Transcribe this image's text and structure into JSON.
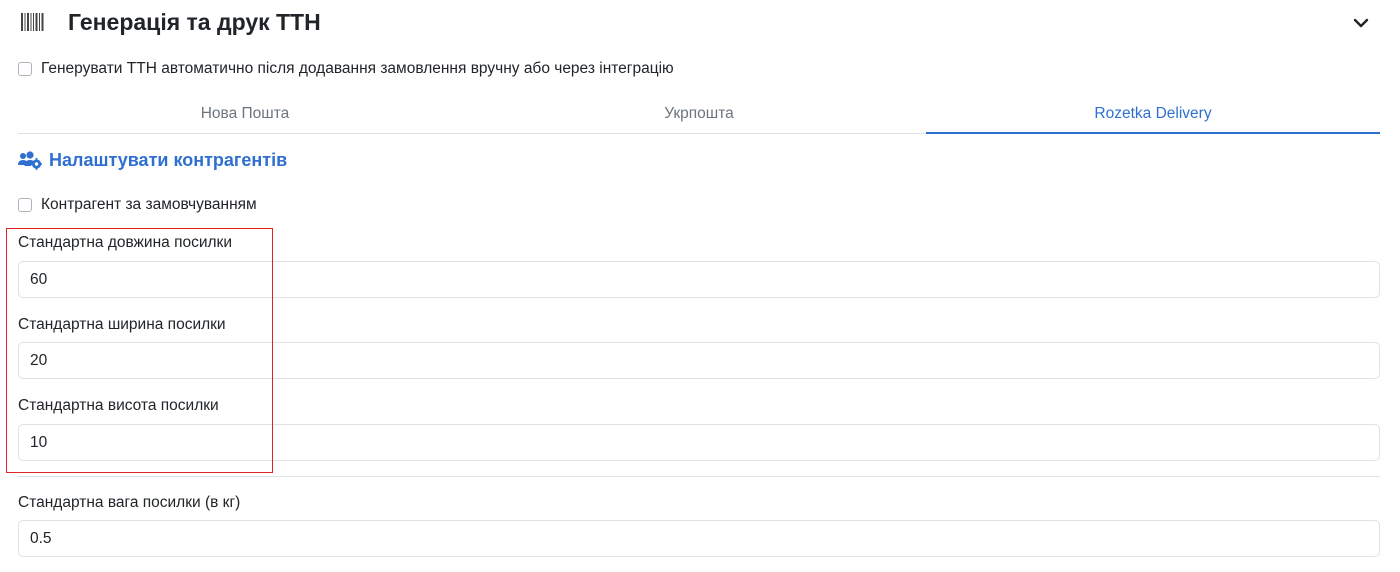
{
  "header": {
    "title": "Генерація та друк ТТН",
    "icon": "barcode-icon",
    "collapse_icon": "chevron-down-icon"
  },
  "auto_generate": {
    "label": "Генерувати ТТН автоматично після додавання замовлення вручну або через інтеграцію",
    "checked": false
  },
  "tabs": [
    {
      "label": "Нова Пошта",
      "active": false
    },
    {
      "label": "Укрпошта",
      "active": false
    },
    {
      "label": "Rozetka Delivery",
      "active": true
    }
  ],
  "contractors_link": {
    "label": "Налаштувати контрагентів",
    "icon": "users-cog-icon"
  },
  "default_contractor": {
    "label": "Контрагент за замовчуванням",
    "checked": false
  },
  "fields": {
    "length": {
      "label": "Стандартна довжина посилки",
      "value": "60"
    },
    "width": {
      "label": "Стандартна ширина посилки",
      "value": "20"
    },
    "height": {
      "label": "Стандартна висота посилки",
      "value": "10"
    },
    "weight": {
      "label": "Стандартна вага посилки (в кг)",
      "value": "0.5"
    }
  },
  "colors": {
    "accent": "#2f6fd1",
    "highlight": "#e02424",
    "border": "#dee2e6",
    "muted_text": "#6c757d"
  }
}
